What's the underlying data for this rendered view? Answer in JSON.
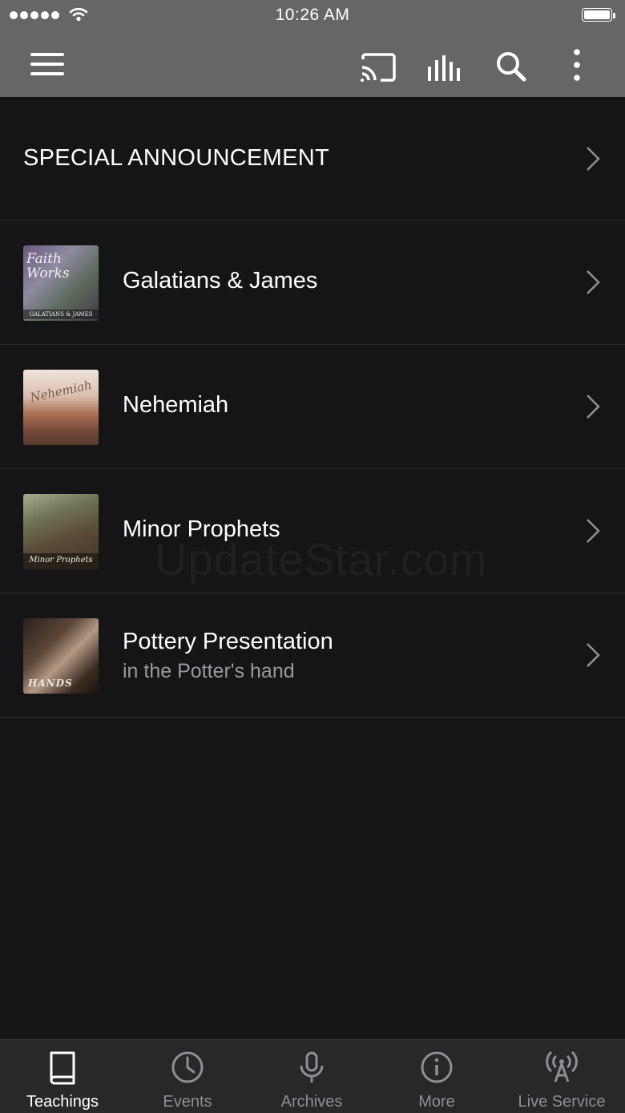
{
  "status_bar": {
    "time": "10:26 AM"
  },
  "app_bar": {
    "icons": [
      "menu-icon",
      "cast-icon",
      "audio-bars-icon",
      "search-icon",
      "more-vertical-icon"
    ]
  },
  "list": {
    "announcement": "SPECIAL ANNOUNCEMENT",
    "items": [
      {
        "title": "Galatians & James",
        "subtitle": "",
        "thumb_text": "Faith Works",
        "thumb_caption": "GALATIANS & JAMES"
      },
      {
        "title": "Nehemiah",
        "subtitle": "",
        "thumb_text": "Nehemiah"
      },
      {
        "title": "Minor Prophets",
        "subtitle": "",
        "thumb_text": "Minor Prophets"
      },
      {
        "title": "Pottery Presentation",
        "subtitle": "in the Potter's hand",
        "thumb_text": "HANDS"
      }
    ]
  },
  "watermark": "UpdateStar.com",
  "tabs": [
    {
      "label": "Teachings",
      "icon": "book-icon",
      "active": true
    },
    {
      "label": "Events",
      "icon": "clock-icon",
      "active": false
    },
    {
      "label": "Archives",
      "icon": "microphone-icon",
      "active": false
    },
    {
      "label": "More",
      "icon": "info-icon",
      "active": false
    },
    {
      "label": "Live Service",
      "icon": "broadcast-icon",
      "active": false
    }
  ],
  "colors": {
    "app_bar": "#666666",
    "background": "#151517",
    "tab_bar": "#28282a",
    "tab_inactive": "#8e8e93"
  }
}
